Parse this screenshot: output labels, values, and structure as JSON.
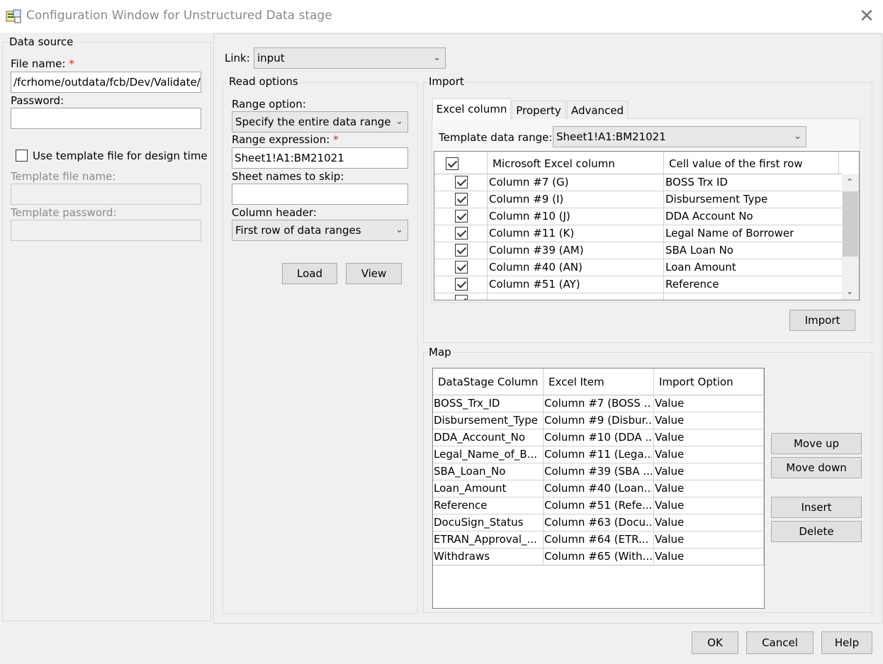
{
  "window": {
    "title": "Configuration Window for Unstructured Data stage",
    "close_glyph": "✕"
  },
  "data_source": {
    "group_title": "Data source",
    "file_name_label": "File name:",
    "required_mark": "*",
    "file_name_value": "/fcrhome/outdata/fcb/Dev/Validate/",
    "password_label": "Password:",
    "password_value": "",
    "use_template_label": "Use template file for design time",
    "template_file_label": "Template file name:",
    "template_password_label": "Template password:"
  },
  "link": {
    "label": "Link:",
    "value": "input"
  },
  "read_options": {
    "group_title": "Read options",
    "range_option_label": "Range option:",
    "range_option_value": "Specify the entire data range",
    "range_expression_label": "Range expression:",
    "range_expression_value": "Sheet1!A1:BM21021",
    "sheet_names_label": "Sheet names to skip:",
    "sheet_names_value": "",
    "column_header_label": "Column header:",
    "column_header_value": "First row of data ranges",
    "load_button": "Load",
    "view_button": "View"
  },
  "import": {
    "group_title": "Import",
    "tabs": [
      "Excel column",
      "Property",
      "Advanced"
    ],
    "template_range_label": "Template data range:",
    "template_range_value": "Sheet1!A1:BM21021",
    "columns": [
      "Microsoft Excel column",
      "Cell value of the first row"
    ],
    "rows": [
      {
        "excel": "Column #7 (G)",
        "value": "BOSS Trx ID"
      },
      {
        "excel": "Column #9 (I)",
        "value": "Disbursement Type"
      },
      {
        "excel": "Column #10 (J)",
        "value": "DDA Account No"
      },
      {
        "excel": "Column #11 (K)",
        "value": "Legal Name of Borrower"
      },
      {
        "excel": "Column #39 (AM)",
        "value": "SBA Loan No"
      },
      {
        "excel": "Column #40 (AN)",
        "value": "Loan Amount"
      },
      {
        "excel": "Column #51 (AY)",
        "value": "Reference"
      }
    ],
    "import_button": "Import"
  },
  "map": {
    "group_title": "Map",
    "columns": [
      "DataStage Column",
      "Excel Item",
      "Import Option"
    ],
    "rows": [
      {
        "ds": "BOSS_Trx_ID",
        "excel": "Column #7 (BOSS ...",
        "opt": "Value"
      },
      {
        "ds": "Disbursement_Type",
        "excel": "Column #9 (Disbur...",
        "opt": "Value"
      },
      {
        "ds": "DDA_Account_No",
        "excel": "Column #10 (DDA ...",
        "opt": "Value"
      },
      {
        "ds": "Legal_Name_of_B...",
        "excel": "Column #11 (Lega...",
        "opt": "Value"
      },
      {
        "ds": "SBA_Loan_No",
        "excel": "Column #39 (SBA ...",
        "opt": "Value"
      },
      {
        "ds": "Loan_Amount",
        "excel": "Column #40 (Loan...",
        "opt": "Value"
      },
      {
        "ds": "Reference",
        "excel": "Column #51 (Refe...",
        "opt": "Value"
      },
      {
        "ds": "DocuSign_Status",
        "excel": "Column #63 (Docu...",
        "opt": "Value"
      },
      {
        "ds": "ETRAN_Approval_...",
        "excel": "Column #64 (ETR...",
        "opt": "Value"
      },
      {
        "ds": "Withdraws",
        "excel": "Column #65 (With...",
        "opt": "Value"
      }
    ],
    "move_up_button": "Move up",
    "move_down_button": "Move down",
    "insert_button": "Insert",
    "delete_button": "Delete"
  },
  "footer": {
    "ok_button": "OK",
    "cancel_button": "Cancel",
    "help_button": "Help"
  }
}
